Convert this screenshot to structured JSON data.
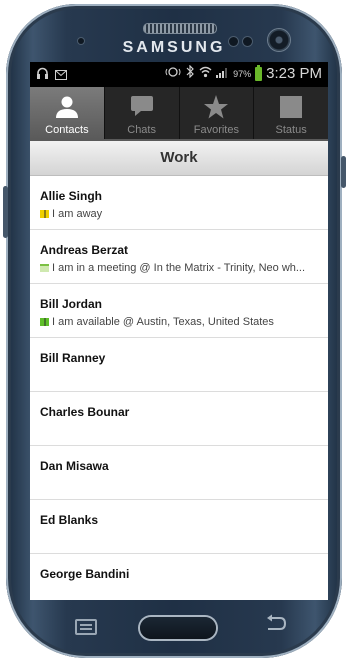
{
  "device": {
    "brand": "SAMSUNG"
  },
  "status_bar": {
    "battery_percent": "97%",
    "time": "3:23 PM",
    "left_icons": [
      "headset-icon",
      "message-icon"
    ],
    "right_icons": [
      "sync-icon",
      "bluetooth-icon",
      "wifi-icon",
      "signal-icon",
      "battery-icon"
    ]
  },
  "tabs": [
    {
      "label": "Contacts",
      "icon": "person-icon",
      "active": true
    },
    {
      "label": "Chats",
      "icon": "chat-bubble-icon",
      "active": false
    },
    {
      "label": "Favorites",
      "icon": "star-icon",
      "active": false
    },
    {
      "label": "Status",
      "icon": "status-square-icon",
      "active": false
    }
  ],
  "group": {
    "title": "Work"
  },
  "contacts": [
    {
      "name": "Allie Singh",
      "status": "I am away",
      "status_type": "away"
    },
    {
      "name": "Andreas Berzat",
      "status": "I am in a meeting @ In the Matrix - Trinity, Neo wh...",
      "status_type": "meeting"
    },
    {
      "name": "Bill Jordan",
      "status": "I am available @ Austin, Texas, United States",
      "status_type": "available"
    },
    {
      "name": "Bill Ranney",
      "status": "",
      "status_type": ""
    },
    {
      "name": "Charles Bounar",
      "status": "",
      "status_type": ""
    },
    {
      "name": "Dan Misawa",
      "status": "",
      "status_type": ""
    },
    {
      "name": "Ed Blanks",
      "status": "",
      "status_type": ""
    },
    {
      "name": "George Bandini",
      "status": "",
      "status_type": ""
    }
  ],
  "colors": {
    "status_away": "#f0d000",
    "status_available": "#5fbf2a",
    "status_meeting": "#7bc043",
    "battery": "#6ab82a"
  },
  "soft_keys": [
    "menu-key-icon",
    "home-button",
    "back-arrow-icon"
  ]
}
